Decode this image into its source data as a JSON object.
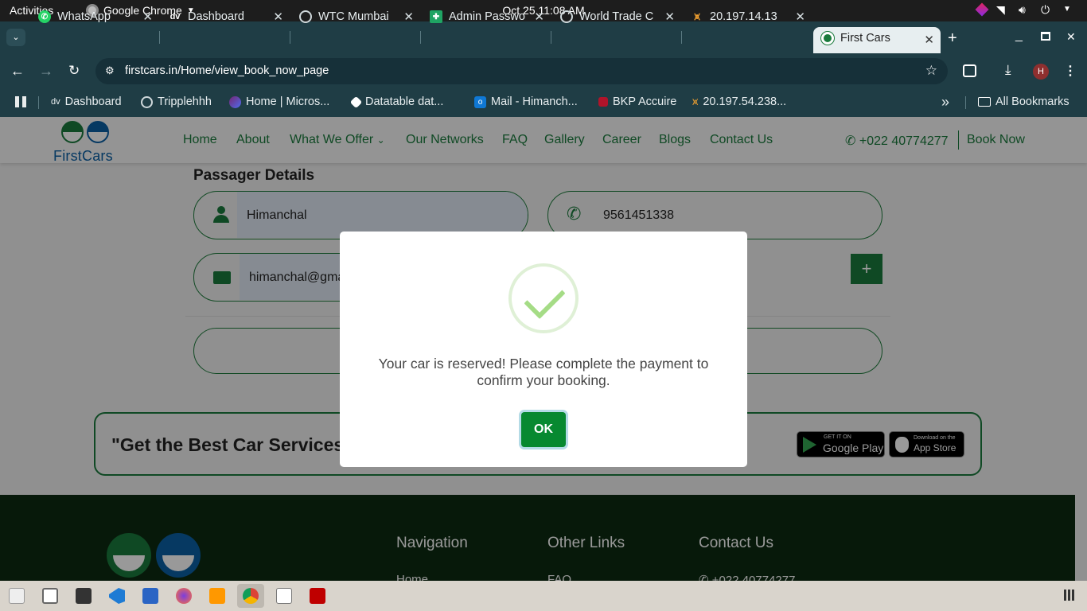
{
  "system": {
    "activities": "Activities",
    "app_name": "Google Chrome",
    "clock": "Oct 25  11:08 AM"
  },
  "tabs": [
    {
      "title": "WhatsApp"
    },
    {
      "title": "Dashboard"
    },
    {
      "title": "WTC Mumbai"
    },
    {
      "title": "Admin Passwo"
    },
    {
      "title": "World Trade C"
    },
    {
      "title": "20.197.14.13"
    },
    {
      "title": "First Cars"
    }
  ],
  "address_bar": {
    "url": "firstcars.in/Home/view_book_now_page"
  },
  "profile_initial": "H",
  "bookmarks": [
    {
      "label": "Dashboard"
    },
    {
      "label": "Tripplehhh"
    },
    {
      "label": "Home | Micros..."
    },
    {
      "label": "Datatable dat..."
    },
    {
      "label": "Mail - Himanch..."
    },
    {
      "label": "BKP Accuire"
    },
    {
      "label": "20.197.54.238..."
    }
  ],
  "bookmarks_more": "»",
  "all_bookmarks": "All Bookmarks",
  "site": {
    "logo_text": "FirstCars",
    "nav": [
      {
        "label": "Home"
      },
      {
        "label": "About"
      },
      {
        "label": "What We Offer"
      },
      {
        "label": "Our Networks"
      },
      {
        "label": "FAQ"
      },
      {
        "label": "Gallery"
      },
      {
        "label": "Career"
      },
      {
        "label": "Blogs"
      },
      {
        "label": "Contact Us"
      }
    ],
    "phone": "+022 40774277",
    "book_now": "Book Now",
    "section_title": "Passager Details",
    "name_value": "Himanchal",
    "phone_value": "9561451338",
    "email_value": "himanchal@gma",
    "plus": "+",
    "banner_text": "\"Get the Best Car Services",
    "google_play_small": "GET IT ON",
    "google_play_big": "Google Play",
    "app_store_small": "Download on the",
    "app_store_big": "App Store",
    "footer": {
      "nav_title": "Navigation",
      "nav_first": "Home",
      "links_title": "Other Links",
      "links_first": "FAQ",
      "contact_title": "Contact Us",
      "contact_first": "+022 40774277"
    }
  },
  "modal": {
    "message": "Your car is reserved! Please complete the payment to confirm your booking.",
    "ok": "OK"
  },
  "colors": {
    "brand_green": "#1a7a3c",
    "ok_button": "#078930",
    "footer_bg": "#0d2a12",
    "logo_blue": "#0b5fa4"
  }
}
